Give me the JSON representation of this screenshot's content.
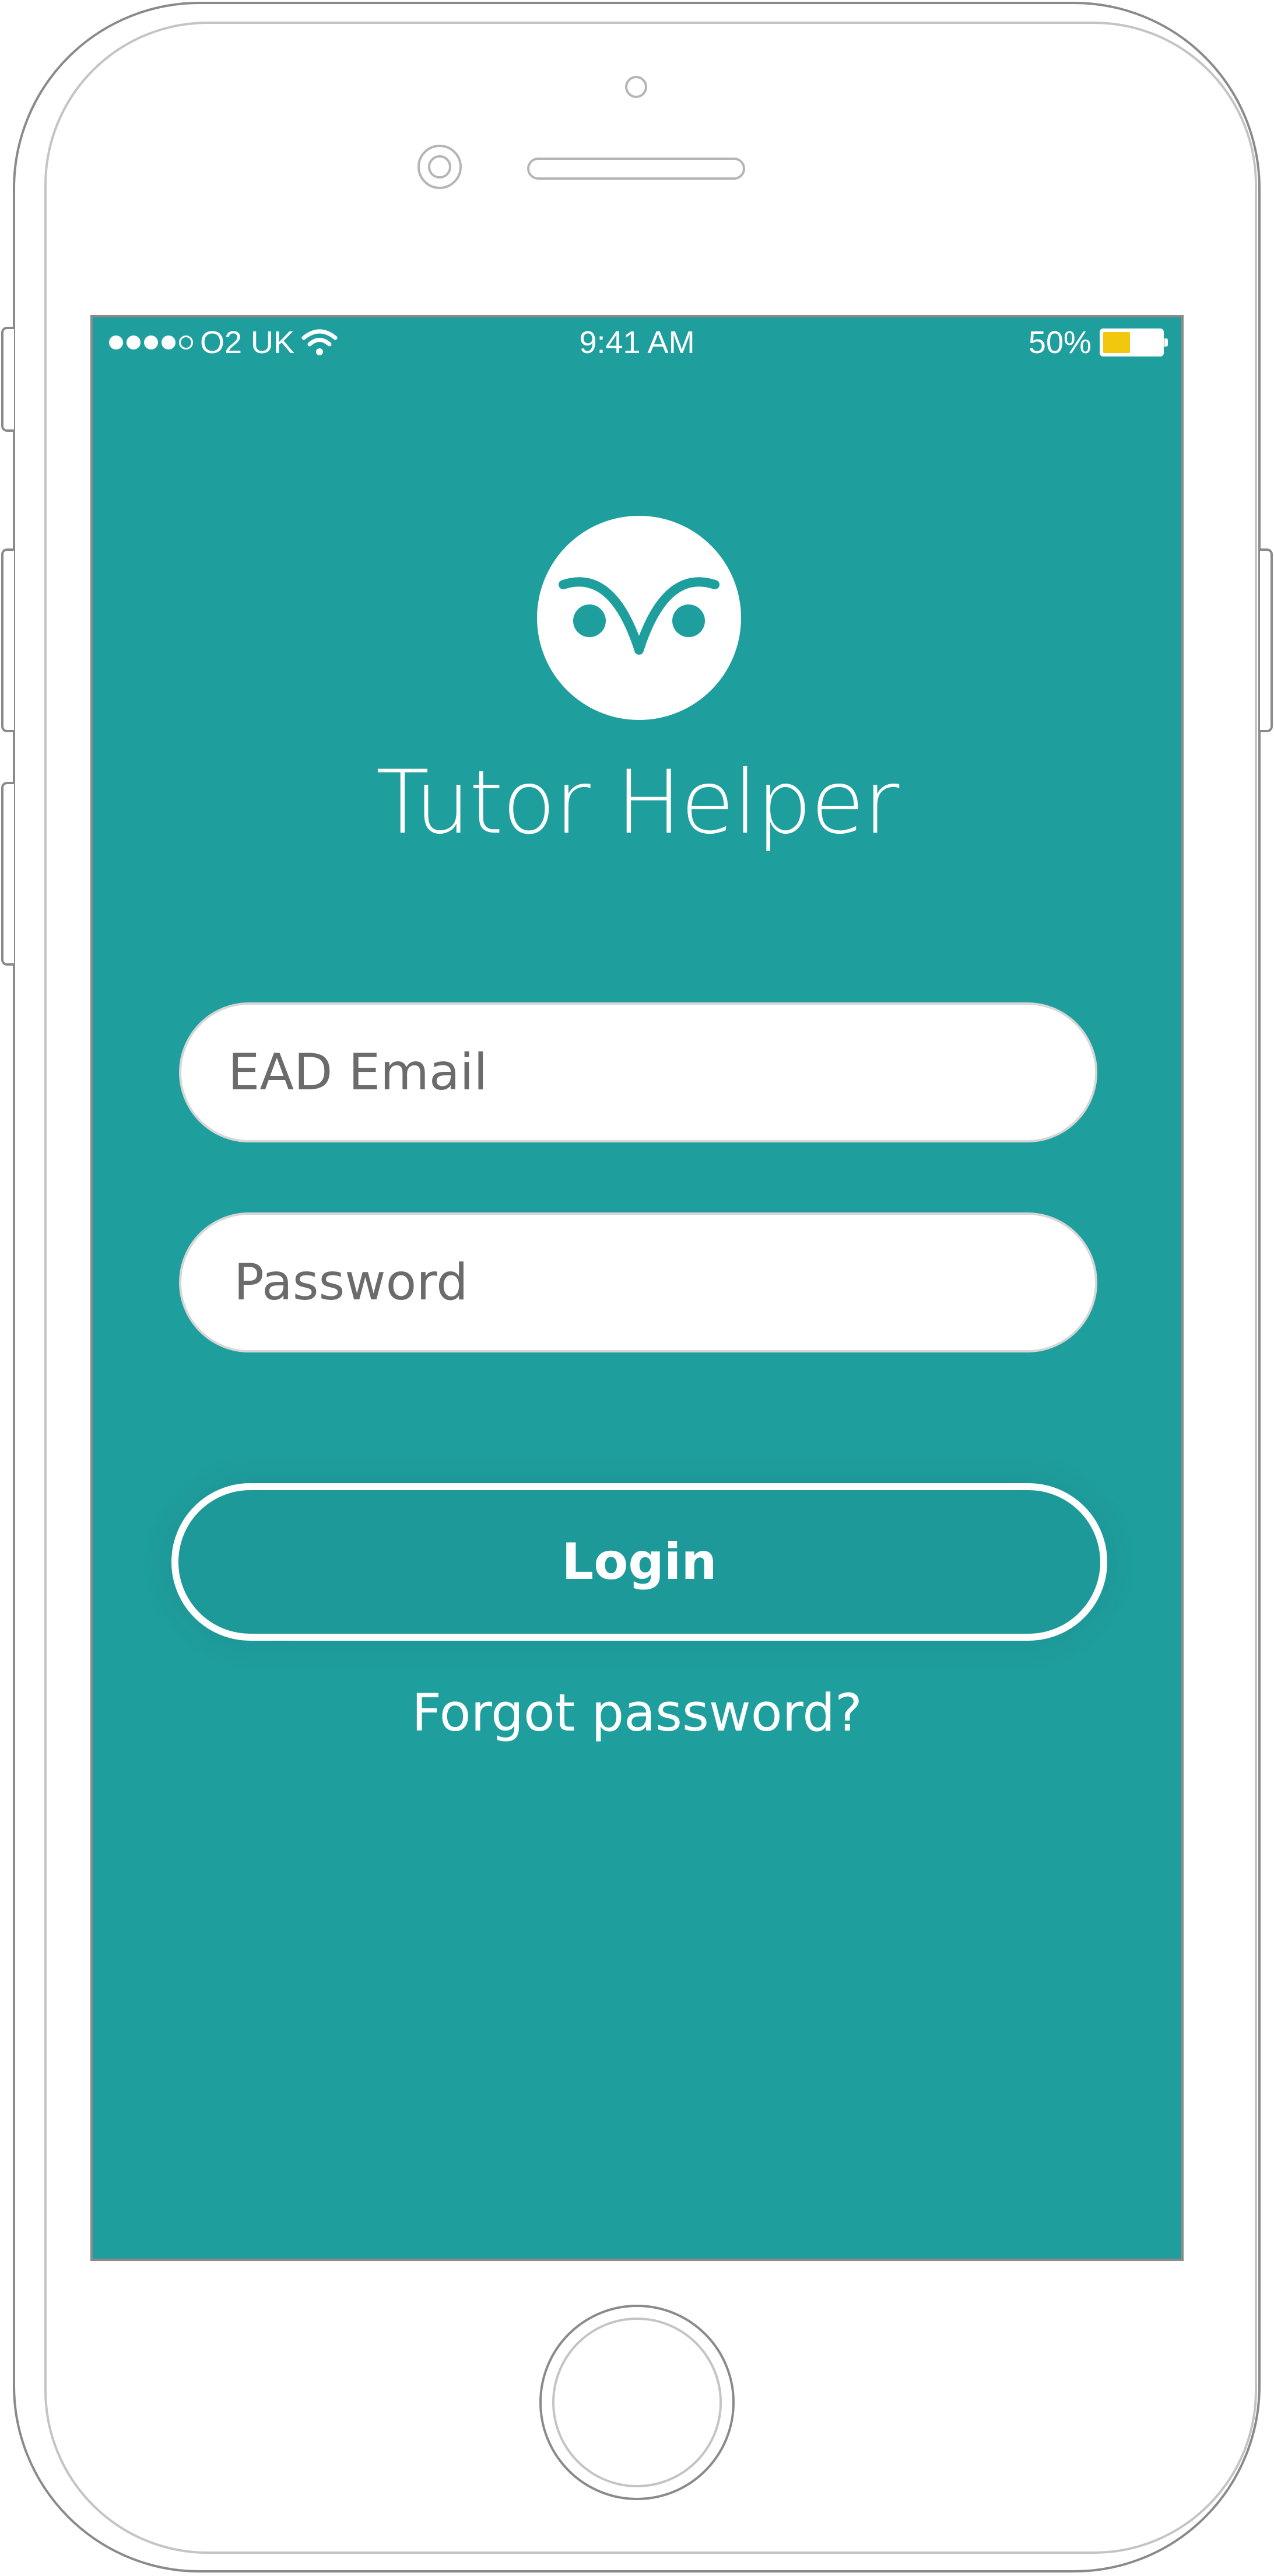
{
  "status_bar": {
    "carrier": "O2 UK",
    "time": "9:41 AM",
    "battery_percent": "50%",
    "battery_level": 0.5,
    "signal_bars_filled": 4,
    "signal_bars_total": 5
  },
  "app": {
    "title": "Tutor Helper",
    "logo_icon": "owl-eyes-icon"
  },
  "login_form": {
    "email_placeholder": "EAD Email",
    "password_placeholder": "Password",
    "login_label": "Login",
    "forgot_password_label": "Forgot password?"
  },
  "colors": {
    "screen_background": "#1f9e9e",
    "field_background": "#ffffff",
    "placeholder_text": "#6b6b6b",
    "battery_fill": "#f2c80f"
  }
}
